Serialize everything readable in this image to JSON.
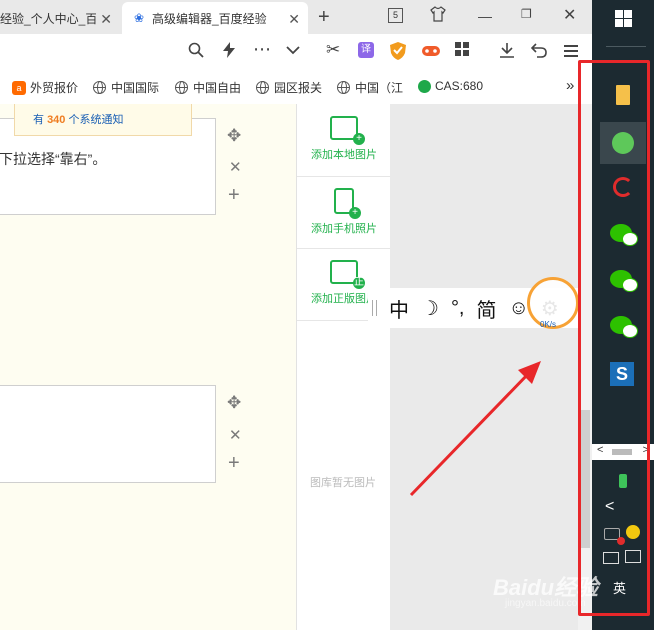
{
  "browser": {
    "tabs": [
      {
        "title": "经验_个人中心_百度",
        "active": false
      },
      {
        "title": "高级编辑器_百度经验",
        "active": true
      }
    ],
    "new_tab_symbol": "+",
    "tab_count": "5",
    "window_controls": {
      "minimize": "—",
      "restore": "❐",
      "close": "✕"
    },
    "toolbar_icons": [
      "search-icon",
      "lightning-icon",
      "more-icon",
      "chevron-down-icon",
      "scissors-icon",
      "translate-icon",
      "shield-icon",
      "game-icon",
      "apps-icon",
      "download-icon",
      "undo-icon",
      "menu-icon"
    ],
    "translate_label": "译",
    "bookmarks": [
      "外贸报价",
      "中国国际",
      "中国自由",
      "园区报关",
      "中国（江",
      "CAS:680"
    ],
    "bookmarks_more": "»"
  },
  "editor": {
    "notification": {
      "prefix": "有",
      "count": "340",
      "suffix": "个系统通知"
    },
    "step1_text": "下拉选择“靠右”。",
    "controls": {
      "move": "✥",
      "delete": "✕",
      "add": "+"
    }
  },
  "image_panel": {
    "options": [
      "添加本地图片",
      "添加手机照片",
      "添加正版图片"
    ],
    "badge": "正",
    "empty_text": "图库暂无图片"
  },
  "ime": {
    "items": [
      "中",
      "☽",
      "°,",
      "简",
      "☺",
      "⚙"
    ],
    "speed": "0K/s"
  },
  "taskbar": {
    "language": "英",
    "watermark": "Baidu经验",
    "watermark_sub": "jingyan.baidu.com",
    "highlight_color": "#e8272a",
    "tray_left_arrow": "<",
    "scroll_left": "<",
    "scroll_right": ">"
  }
}
